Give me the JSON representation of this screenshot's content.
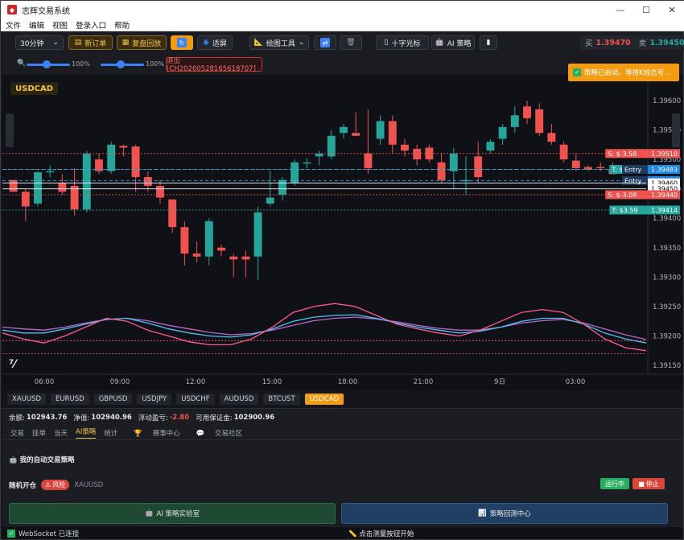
{
  "window": {
    "title": "志辉交易系统",
    "min": "—",
    "max": "☐",
    "close": "✕"
  },
  "menu": [
    "文件",
    "编辑",
    "视图",
    "登录入口",
    "帮助"
  ],
  "toolbar": {
    "timeframe": "30分钟",
    "new_order": "新订单",
    "replay": "复盘回放",
    "fit": "适屏",
    "draw_tools": "绘图工具",
    "crosshair": "十字光标",
    "ai_strategy": "AI 策略",
    "buy_label": "买",
    "buy_price": "1.39470",
    "sell_label": "卖",
    "sell_price": "1.39450"
  },
  "zoom": {
    "left_pct": "100%",
    "right_pct": "100%",
    "exit_label": "退出 [CH20260528165618707]"
  },
  "toast": "策略已启动，等待K线信号...",
  "symbol": "USDCAD",
  "colors": {
    "up": "#26a69a",
    "down": "#ef5350",
    "accent": "#f39c12",
    "bg": "#0f1117"
  },
  "chart_data": {
    "type": "candlestick",
    "symbol": "USDCAD",
    "x_ticks": [
      "06:00",
      "09:00",
      "12:00",
      "15:00",
      "18:00",
      "21:00",
      "9日",
      "03:00"
    ],
    "y_ticks": [
      "1.39600",
      "1.39550",
      "1.39500",
      "1.39450",
      "1.39400",
      "1.39350",
      "1.39300",
      "1.39250",
      "1.39200",
      "1.39150"
    ],
    "ylim": [
      1.39135,
      1.3963
    ],
    "candles": [
      [
        1.39465,
        1.39465,
        1.39445,
        1.39445
      ],
      [
        1.39445,
        1.3945,
        1.39395,
        1.3942
      ],
      [
        1.39425,
        1.3948,
        1.3942,
        1.39478
      ],
      [
        1.39478,
        1.3949,
        1.3947,
        1.3948
      ],
      [
        1.3946,
        1.39475,
        1.3944,
        1.39445
      ],
      [
        1.39455,
        1.39485,
        1.39405,
        1.39415
      ],
      [
        1.39415,
        1.39515,
        1.3941,
        1.3951
      ],
      [
        1.395,
        1.3951,
        1.39475,
        1.3948
      ],
      [
        1.3948,
        1.3953,
        1.39475,
        1.39525
      ],
      [
        1.39523,
        1.39525,
        1.39505,
        1.3952
      ],
      [
        1.39522,
        1.39525,
        1.39445,
        1.3947
      ],
      [
        1.3947,
        1.3948,
        1.39445,
        1.39455
      ],
      [
        1.39455,
        1.39465,
        1.39425,
        1.39435
      ],
      [
        1.39432,
        1.39432,
        1.39375,
        1.39385
      ],
      [
        1.39385,
        1.39395,
        1.3932,
        1.3934
      ],
      [
        1.3934,
        1.3936,
        1.39325,
        1.39335
      ],
      [
        1.39335,
        1.394,
        1.3932,
        1.39395
      ],
      [
        1.3935,
        1.39355,
        1.39335,
        1.39345
      ],
      [
        1.39335,
        1.3934,
        1.393,
        1.3933
      ],
      [
        1.39335,
        1.39345,
        1.393,
        1.3933
      ],
      [
        1.39335,
        1.3942,
        1.39295,
        1.3941
      ],
      [
        1.39425,
        1.3948,
        1.3942,
        1.39435
      ],
      [
        1.3944,
        1.3947,
        1.3943,
        1.39465
      ],
      [
        1.3946,
        1.395,
        1.39455,
        1.39495
      ],
      [
        1.39495,
        1.39502,
        1.39485,
        1.39495
      ],
      [
        1.39505,
        1.39515,
        1.3949,
        1.3951
      ],
      [
        1.39505,
        1.3955,
        1.395,
        1.3954
      ],
      [
        1.39545,
        1.3956,
        1.39535,
        1.39555
      ],
      [
        1.39545,
        1.3958,
        1.3954,
        1.3954
      ],
      [
        1.3951,
        1.39585,
        1.39475,
        1.39485
      ],
      [
        1.39535,
        1.39575,
        1.39525,
        1.39565
      ],
      [
        1.39565,
        1.39575,
        1.3951,
        1.39525
      ],
      [
        1.39525,
        1.39535,
        1.39505,
        1.39515
      ],
      [
        1.39518,
        1.39525,
        1.3949,
        1.395
      ],
      [
        1.3952,
        1.39525,
        1.39495,
        1.395
      ],
      [
        1.39495,
        1.3951,
        1.3946,
        1.39465
      ],
      [
        1.3948,
        1.3952,
        1.3945,
        1.3951
      ],
      [
        1.39465,
        1.39505,
        1.3944,
        1.39465
      ],
      [
        1.39505,
        1.3953,
        1.3946,
        1.3947
      ],
      [
        1.39515,
        1.39535,
        1.3951,
        1.3953
      ],
      [
        1.39535,
        1.3956,
        1.39525,
        1.39555
      ],
      [
        1.39555,
        1.3959,
        1.39545,
        1.39575
      ],
      [
        1.3959,
        1.396,
        1.3956,
        1.3957
      ],
      [
        1.39585,
        1.39595,
        1.3954,
        1.39545
      ],
      [
        1.39545,
        1.3956,
        1.39525,
        1.3953
      ],
      [
        1.39525,
        1.3953,
        1.39495,
        1.395
      ],
      [
        1.39498,
        1.3951,
        1.3948,
        1.39485
      ],
      [
        1.39487,
        1.3949,
        1.3948,
        1.39483
      ],
      [
        1.39487,
        1.39495,
        1.3948,
        1.39486
      ],
      [
        1.39483,
        1.39495,
        1.39478,
        1.39475
      ]
    ],
    "lines": [
      {
        "label": "S: $-3.58",
        "price_label": "1.39510",
        "price": 1.3951,
        "color": "#ef5350",
        "style": "dotted"
      },
      {
        "label": "T: $0.00",
        "price_label": "1.39483",
        "price": 1.39483,
        "color": "#26a69a",
        "style": "dotted"
      },
      {
        "label": "Entry",
        "price_label": "1.39483",
        "price": 1.39483,
        "color": "#42a5f5",
        "style": "dashed"
      },
      {
        "label": "Entry",
        "price_label": "1.39464",
        "price": 1.39464,
        "color": "#42a5f5",
        "style": "dashed"
      },
      {
        "label": "",
        "price_label": "1.39460",
        "price": 1.3946,
        "color": "#ffffff",
        "style": "solid"
      },
      {
        "label": "",
        "price_label": "1.39450",
        "price": 1.3945,
        "color": "#ffffff",
        "style": "solid"
      },
      {
        "label": "S: $-3.08",
        "price_label": "1.39440",
        "price": 1.3944,
        "color": "#ef5350",
        "style": "dotted"
      },
      {
        "label": "T: $3.59",
        "price_label": "1.39414",
        "price": 1.39414,
        "color": "#26a69a",
        "style": "dotted"
      }
    ],
    "indicator": {
      "pink": [
        1.39205,
        1.39195,
        1.39188,
        1.392,
        1.39215,
        1.3923,
        1.39225,
        1.3921,
        1.392,
        1.3919,
        1.39185,
        1.39185,
        1.39195,
        1.39215,
        1.3924,
        1.3925,
        1.39255,
        1.3925,
        1.39235,
        1.3922,
        1.39212,
        1.39205,
        1.392,
        1.3921,
        1.39225,
        1.3924,
        1.39245,
        1.3924,
        1.3922,
        1.39195,
        1.3918,
        1.39175
      ],
      "blue": [
        1.3921,
        1.39205,
        1.39205,
        1.39212,
        1.3922,
        1.39228,
        1.3923,
        1.39222,
        1.39212,
        1.39205,
        1.392,
        1.39198,
        1.39202,
        1.39212,
        1.39225,
        1.39232,
        1.39235,
        1.39236,
        1.3923,
        1.39222,
        1.39215,
        1.3921,
        1.39205,
        1.39208,
        1.39215,
        1.39225,
        1.3923,
        1.3923,
        1.3922,
        1.39205,
        1.39195,
        1.39188
      ],
      "purple": [
        1.39215,
        1.39212,
        1.3921,
        1.39215,
        1.39222,
        1.39228,
        1.3923,
        1.39226,
        1.39218,
        1.39212,
        1.39206,
        1.39202,
        1.39204,
        1.3921,
        1.39218,
        1.39226,
        1.3923,
        1.39232,
        1.39229,
        1.39224,
        1.39218,
        1.39213,
        1.3921,
        1.3921,
        1.39215,
        1.39222,
        1.39226,
        1.39228,
        1.39222,
        1.39212,
        1.39202,
        1.39194
      ]
    },
    "grid": false
  },
  "symbols": [
    "XAUUSD",
    "EURUSD",
    "GBPUSD",
    "USDJPY",
    "USDCHF",
    "AUDUSD",
    "BTCUST",
    "USDCAD"
  ],
  "account": {
    "balance_label": "余额:",
    "balance": "102943.76",
    "equity_label": "净值:",
    "equity": "102940.96",
    "floating_label": "浮动盈亏:",
    "floating": "-2.80",
    "margin_label": "可用保证金:",
    "margin": "102900.96"
  },
  "tabs": [
    "交易",
    "挂单",
    "当天",
    "AI策略",
    "统计",
    "赛事中心",
    "交易社区"
  ],
  "panel": {
    "title": "我的自动交易策略",
    "strategy_name": "随机开仓",
    "risk": "风险",
    "symbol": "XAUUSD",
    "running": "运行中",
    "stop": "停止",
    "lab": "AI 策略实验室",
    "backtest": "策略回测中心"
  },
  "status": {
    "ws": "WebSocket 已连接",
    "hint": "点击测量按钮开始"
  }
}
